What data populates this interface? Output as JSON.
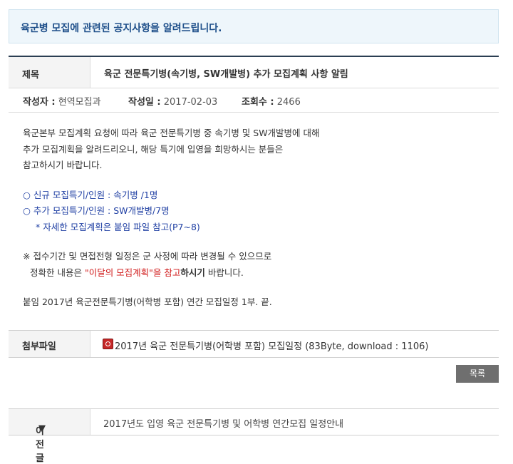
{
  "notice": "육군병 모집에 관련된 공지사항을 알려드립니다.",
  "post": {
    "title_label": "제목",
    "title": "육군 전문특기병(속기병, SW개발병) 추가 모집계획 사항 알림",
    "author_label": "작성자 :",
    "author": "현역모집과",
    "date_label": "작성일 :",
    "date": "2017-02-03",
    "views_label": "조회수 :",
    "views": "2466"
  },
  "body": {
    "p1": [
      "육군본부 모집계획 요청에 따라 육군 전문특기병 중 속기병 및 SW개발병에 대해",
      "추가 모집계획을 알려드리오니, 해당 특기에 입영을 희망하시는 분들은",
      "참고하시기 바랍니다."
    ],
    "item1": "○ 신규 모집특기/인원 : 속기병 /1명",
    "item2": "○ 추가 모집특기/인원 : SW개발병/7명",
    "item3": "* 자세한 모집계획은 붙임 파일 참고(P7~8)",
    "note1": "※ 접수기간 및 면접전형 일정은 군 사정에 따라 변경될 수 있으므로",
    "note2_a": "정확한 내용은 ",
    "note2_b": "\"이달의 모집계획\"을 참고",
    "note2_c": "하시기",
    "note2_d": " 바랍니다.",
    "attach_note": "붙임 2017년 육군전문특기병(어학병 포함) 연간 모집일정 1부.  끝."
  },
  "attachment": {
    "label": "첨부파일",
    "icon": "pdf-file-icon",
    "text": "2017년 육군 전문특기병(어학병 포함) 모집일정 (83Byte, download : 1106)"
  },
  "list_button": "목록",
  "prev": {
    "label": "이전글",
    "arrow": "▼",
    "title": "2017년도 입영 육군 전문특기병 및 어학병 연간모집 일정안내"
  }
}
